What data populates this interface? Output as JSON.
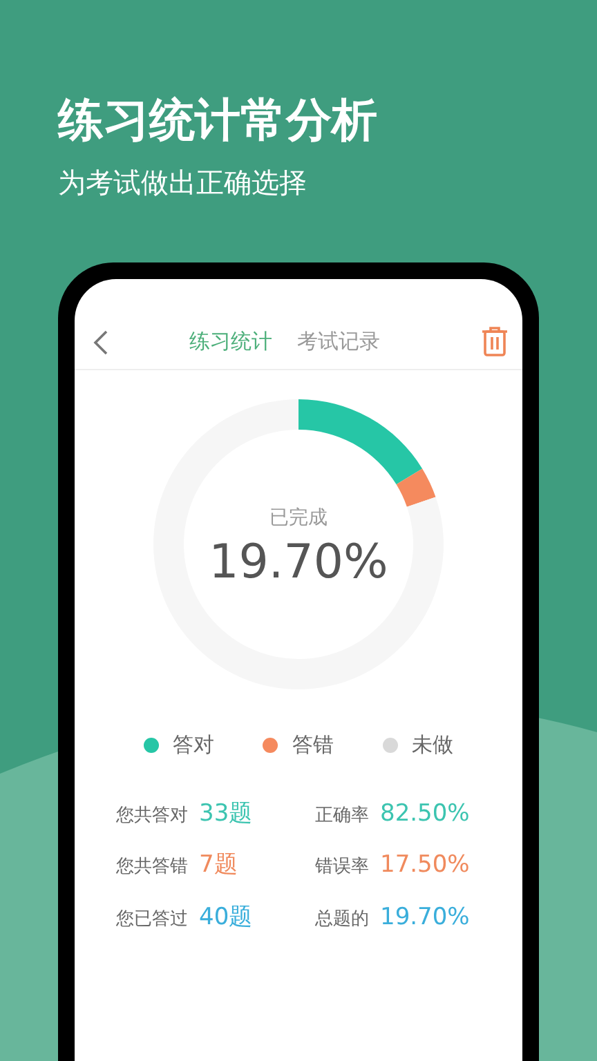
{
  "headline": "练习统计常分析",
  "subheadline": "为考试做出正确选择",
  "tabs": [
    {
      "label": "练习统计",
      "selected": true
    },
    {
      "label": "考试记录",
      "selected": false
    }
  ],
  "donut": {
    "caption": "已完成",
    "percent": "19.70%",
    "chart_data": {
      "type": "donut",
      "categories": [
        "答对",
        "答错",
        "未做"
      ],
      "values": [
        16.26,
        3.45,
        80.29
      ]
    }
  },
  "legend": [
    {
      "color": "#26c6a6"
    },
    {
      "color": "#f58a5e"
    },
    {
      "color": "#d9d9d9"
    }
  ],
  "stats": [
    {
      "label": "您共答对",
      "value": "33题",
      "color": "#3cc4b0"
    },
    {
      "label": "正确率",
      "value": "82.50%",
      "color": "#3cc4b0"
    },
    {
      "label": "您共答错",
      "value": "7题",
      "color": "#f08a5d"
    },
    {
      "label": "错误率",
      "value": "17.50%",
      "color": "#f08a5d"
    },
    {
      "label": "您已答过",
      "value": "40题",
      "color": "#3aaedb"
    },
    {
      "label": "总题的",
      "value": "19.70%",
      "color": "#3aaedb"
    }
  ]
}
